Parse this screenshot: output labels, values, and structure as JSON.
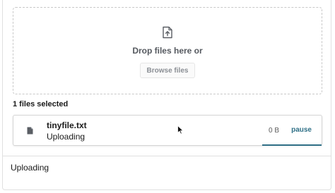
{
  "dropzone": {
    "icon": "file-upload-icon",
    "text": "Drop files here or",
    "browse_label": "Browse files"
  },
  "files_selected_label": "1 files selected",
  "file": {
    "icon": "file-icon",
    "name": "tinyfile.txt",
    "status": "Uploading",
    "size": "0 B",
    "action_label": "pause",
    "progress_percent": 100
  },
  "footer": {
    "status": "Uploading"
  },
  "colors": {
    "accent": "#2e6f86",
    "icon": "#5a5e64",
    "text": "#1a1a1a"
  }
}
